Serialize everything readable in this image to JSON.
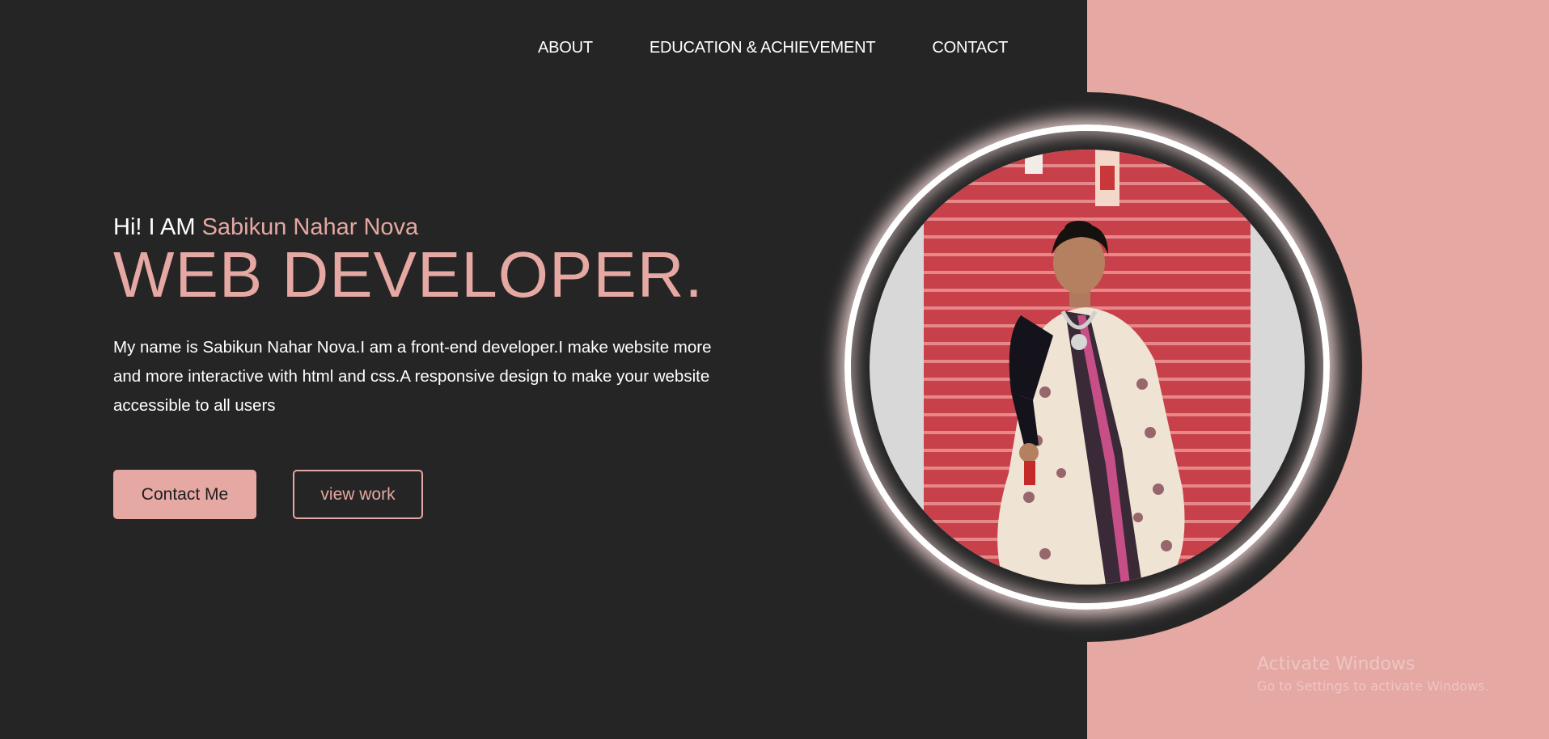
{
  "nav": {
    "items": [
      "ABOUT",
      "EDUCATION & ACHIEVEMENT",
      "CONTACT"
    ]
  },
  "hero": {
    "greeting_prefix": "Hi! I AM",
    "name": "Sabikun Nahar Nova",
    "role": "WEB DEVELOPER.",
    "description": "My name is Sabikun Nahar Nova.I am a front-end developer.I make website more and more interactive with html and css.A responsive design to make your website accessible to all users"
  },
  "buttons": {
    "contact_label": "Contact Me",
    "work_label": "view work"
  },
  "watermark": {
    "title": "Activate Windows",
    "subtitle": "Go to Settings to activate Windows."
  },
  "colors": {
    "background": "#252525",
    "accent": "#e5a8a3",
    "text": "#ffffff"
  }
}
